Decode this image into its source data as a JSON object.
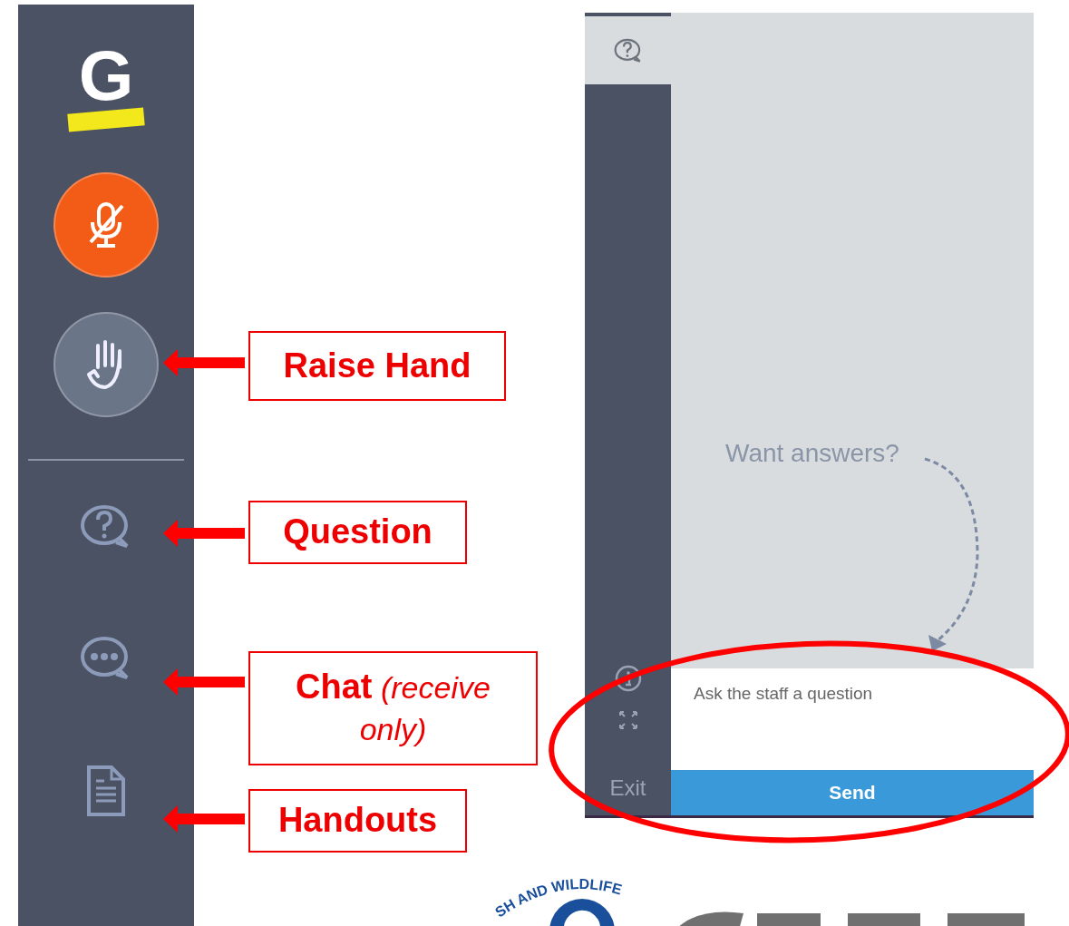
{
  "sidebar": {
    "logo": "G",
    "items": [
      {
        "kind": "mic",
        "muted": true
      },
      {
        "kind": "hand"
      },
      {
        "kind": "divider"
      },
      {
        "kind": "question"
      },
      {
        "kind": "chat"
      },
      {
        "kind": "handout"
      }
    ]
  },
  "callouts": [
    {
      "label": "Raise Hand"
    },
    {
      "label": "Question"
    },
    {
      "label": "Chat",
      "note": "(receive only)"
    },
    {
      "label": "Handouts"
    }
  ],
  "panel": {
    "tabs": [
      {
        "kind": "question",
        "selected": true
      }
    ],
    "prompt": "Want answers?",
    "question_field": {
      "placeholder": "Ask the staff a question"
    },
    "send_button": "Send",
    "side_tools": [
      {
        "kind": "info"
      },
      {
        "kind": "fullscreen"
      }
    ],
    "exit": "Exit"
  },
  "footer_logo": {
    "text": "SH AND WILDLIFE"
  }
}
